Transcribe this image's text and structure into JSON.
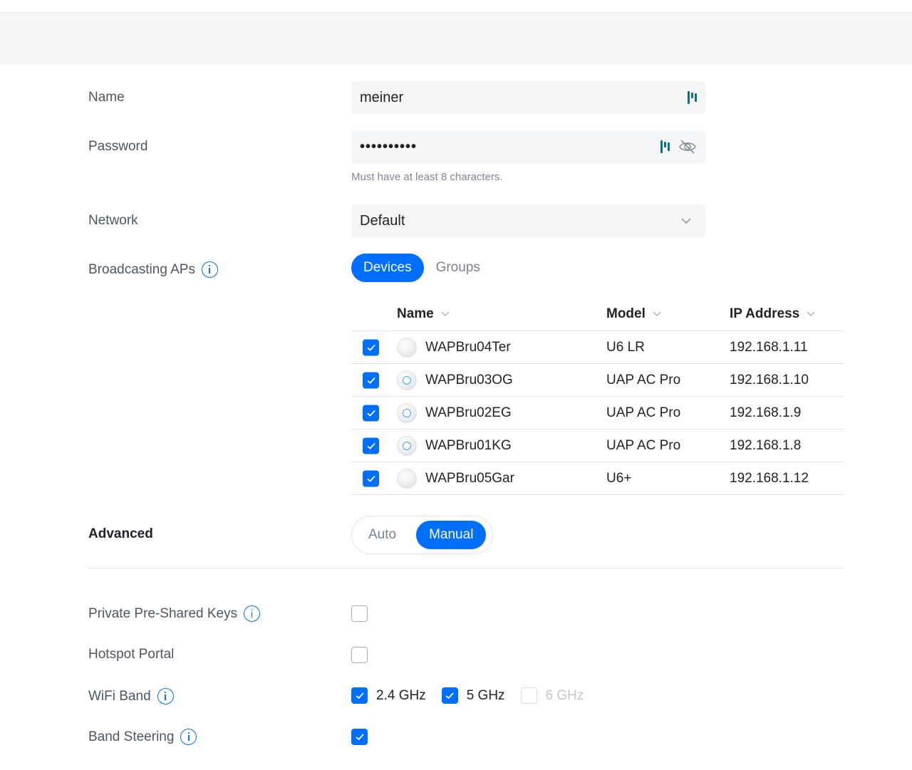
{
  "form": {
    "name": {
      "label": "Name",
      "value": "meiner",
      "icon": "password-manager-icon"
    },
    "password": {
      "label": "Password",
      "value": "••••••••••",
      "helper": "Must have at least 8 characters.",
      "icons": [
        "password-manager-icon",
        "eye-off-icon"
      ]
    },
    "network": {
      "label": "Network",
      "value": "Default",
      "icon": "chevron-down-icon"
    },
    "broadcasting": {
      "label": "Broadcasting APs",
      "tabs": [
        {
          "label": "Devices",
          "active": true
        },
        {
          "label": "Groups",
          "active": false
        }
      ],
      "table": {
        "columns": [
          "Name",
          "Model",
          "IP Address"
        ],
        "rows": [
          {
            "checked": true,
            "icon": "access-point-icon",
            "name": "WAPBru04Ter",
            "model": "U6 LR",
            "ip": "192.168.1.11"
          },
          {
            "checked": true,
            "icon": "access-point-ring-icon",
            "name": "WAPBru03OG",
            "model": "UAP AC Pro",
            "ip": "192.168.1.10"
          },
          {
            "checked": true,
            "icon": "access-point-ring-icon",
            "name": "WAPBru02EG",
            "model": "UAP AC Pro",
            "ip": "192.168.1.9"
          },
          {
            "checked": true,
            "icon": "access-point-ring-icon",
            "name": "WAPBru01KG",
            "model": "UAP AC Pro",
            "ip": "192.168.1.8"
          },
          {
            "checked": true,
            "icon": "access-point-icon",
            "name": "WAPBru05Gar",
            "model": "U6+",
            "ip": "192.168.1.12"
          }
        ]
      }
    },
    "advanced": {
      "label": "Advanced",
      "options": [
        {
          "label": "Auto",
          "active": false
        },
        {
          "label": "Manual",
          "active": true
        }
      ]
    },
    "ppsk": {
      "label": "Private Pre-Shared Keys",
      "checked": false
    },
    "hotspot": {
      "label": "Hotspot Portal",
      "checked": false
    },
    "wifi_band": {
      "label": "WiFi Band",
      "bands": [
        {
          "label": "2.4 GHz",
          "checked": true,
          "disabled": false
        },
        {
          "label": "5 GHz",
          "checked": true,
          "disabled": false
        },
        {
          "label": "6 GHz",
          "checked": false,
          "disabled": true
        }
      ]
    },
    "band_steering": {
      "label": "Band Steering",
      "checked": true
    }
  },
  "colors": {
    "accent": "#006fff",
    "label": "#50565e",
    "text": "#212327",
    "muted": "#7d838c",
    "field_bg": "#f4f5f6",
    "border": "#e4e5e8"
  }
}
